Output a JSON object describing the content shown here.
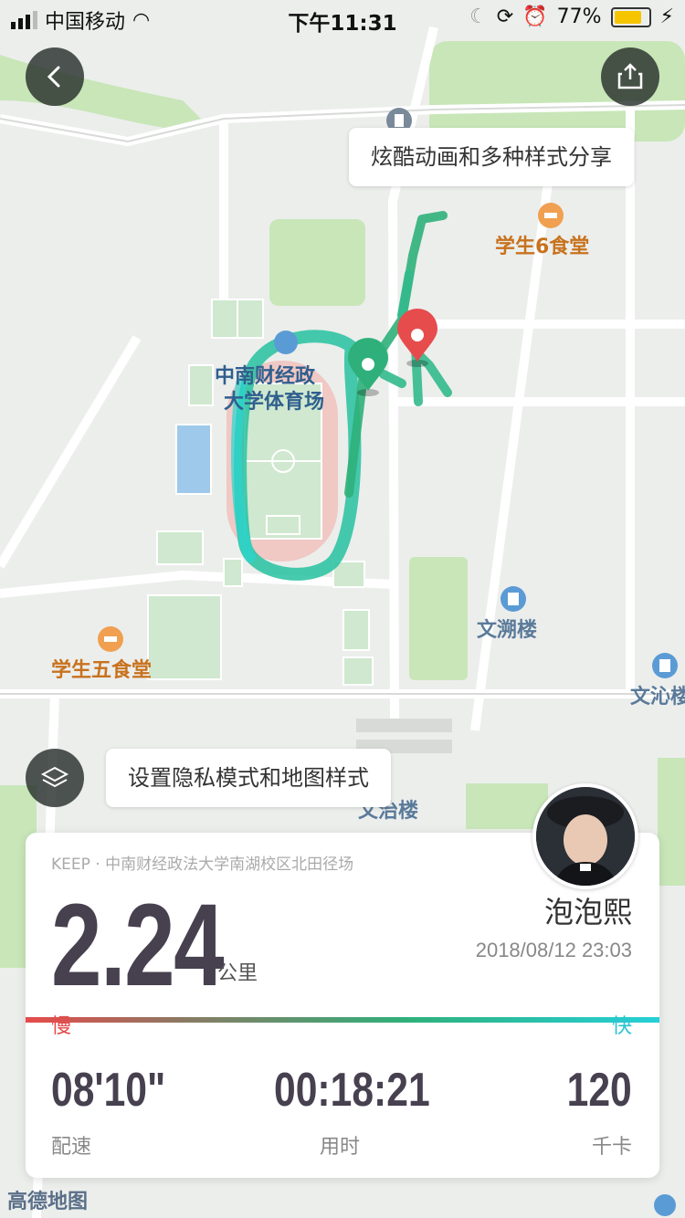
{
  "status_bar": {
    "carrier": "中国移动",
    "time": "下午11:31",
    "battery": "77%"
  },
  "map": {
    "pois": {
      "student_canteen_6": "学生6食堂",
      "student_canteen_5": "学生五食堂",
      "stadium_line1": "中南财经政",
      "stadium_line2": "大学体育场",
      "wensu_building": "文溯楼",
      "wenqin_building": "文沁楼",
      "wenzhi_building": "文治楼",
      "watermark": "高德地图"
    }
  },
  "tooltips": {
    "share": "炫酷动画和多种样式分享",
    "privacy": "设置隐私模式和地图样式"
  },
  "card": {
    "source": "KEEP · 中南财经政法大学南湖校区北田径场",
    "distance": "2.24",
    "unit": "公里",
    "username": "泡泡熙",
    "datetime": "2018/08/12 23:03",
    "slow_label": "慢",
    "fast_label": "快",
    "stats": [
      {
        "value": "08'10\"",
        "label": "配速"
      },
      {
        "value": "00:18:21",
        "label": "用时"
      },
      {
        "value": "120",
        "label": "千卡"
      }
    ]
  },
  "colors": {
    "track": "#2ec3a6",
    "start_pin": "#2fb07a",
    "end_pin": "#e74c4c"
  }
}
